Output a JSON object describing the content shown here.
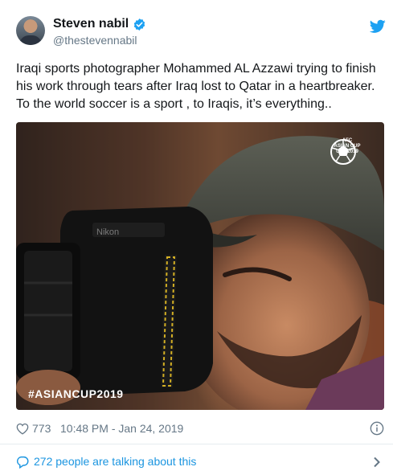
{
  "author": {
    "name": "Steven nabil",
    "handle": "@thestevennabil",
    "verified": true
  },
  "icons": {
    "verified": "verified-badge-icon",
    "platform": "twitter-bird-icon",
    "like": "heart-icon",
    "info": "info-icon",
    "conversation": "speech-bubble-icon",
    "more": "chevron-right-icon"
  },
  "tweet": {
    "lines": [
      "Iraqi sports photographer Mohammed AL Azzawi trying to finish",
      "his work through tears after Iraq lost to Qatar in a heartbreaker.",
      "To the world soccer is a sport , to Iraqis, it’s everything.."
    ]
  },
  "media": {
    "hashtag_overlay": "#ASIANCUP2019",
    "camera_brand": "Nikon",
    "logo_lines": [
      "AFC",
      "ASIAN CUP",
      "UAE 2019"
    ]
  },
  "footer": {
    "likes": "773",
    "timestamp": "10:48 PM - Jan 24, 2019",
    "talking_label": "272 people are talking about this"
  },
  "colors": {
    "link_blue": "#1b95e0",
    "muted_gray": "#657786",
    "verified_blue": "#1da1f2",
    "divider": "#e6ecf0"
  }
}
